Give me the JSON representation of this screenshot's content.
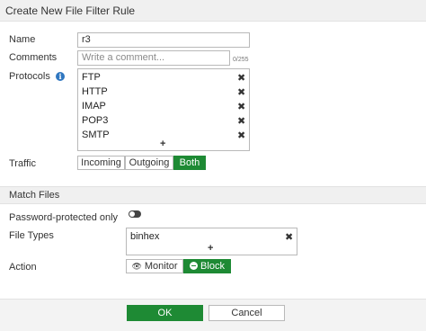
{
  "dialog": {
    "title": "Create New File Filter Rule"
  },
  "form": {
    "name": {
      "label": "Name",
      "value": "r3"
    },
    "comments": {
      "label": "Comments",
      "placeholder": "Write a comment...",
      "counter": "0/255"
    },
    "protocols": {
      "label": "Protocols",
      "items": [
        "FTP",
        "HTTP",
        "IMAP",
        "POP3",
        "SMTP"
      ],
      "add_symbol": "+",
      "remove_symbol": "✖"
    },
    "traffic": {
      "label": "Traffic",
      "options": [
        "Incoming",
        "Outgoing",
        "Both"
      ],
      "selected": "Both"
    }
  },
  "match_files": {
    "section_title": "Match Files",
    "password_protected": {
      "label": "Password-protected only",
      "enabled": false
    },
    "file_types": {
      "label": "File Types",
      "items": [
        "binhex"
      ],
      "add_symbol": "+",
      "remove_symbol": "✖"
    },
    "action": {
      "label": "Action",
      "options": [
        "Monitor",
        "Block"
      ],
      "selected": "Block"
    }
  },
  "footer": {
    "ok_label": "OK",
    "cancel_label": "Cancel"
  },
  "colors": {
    "accent": "#1e8a34",
    "info": "#2f77c0"
  }
}
